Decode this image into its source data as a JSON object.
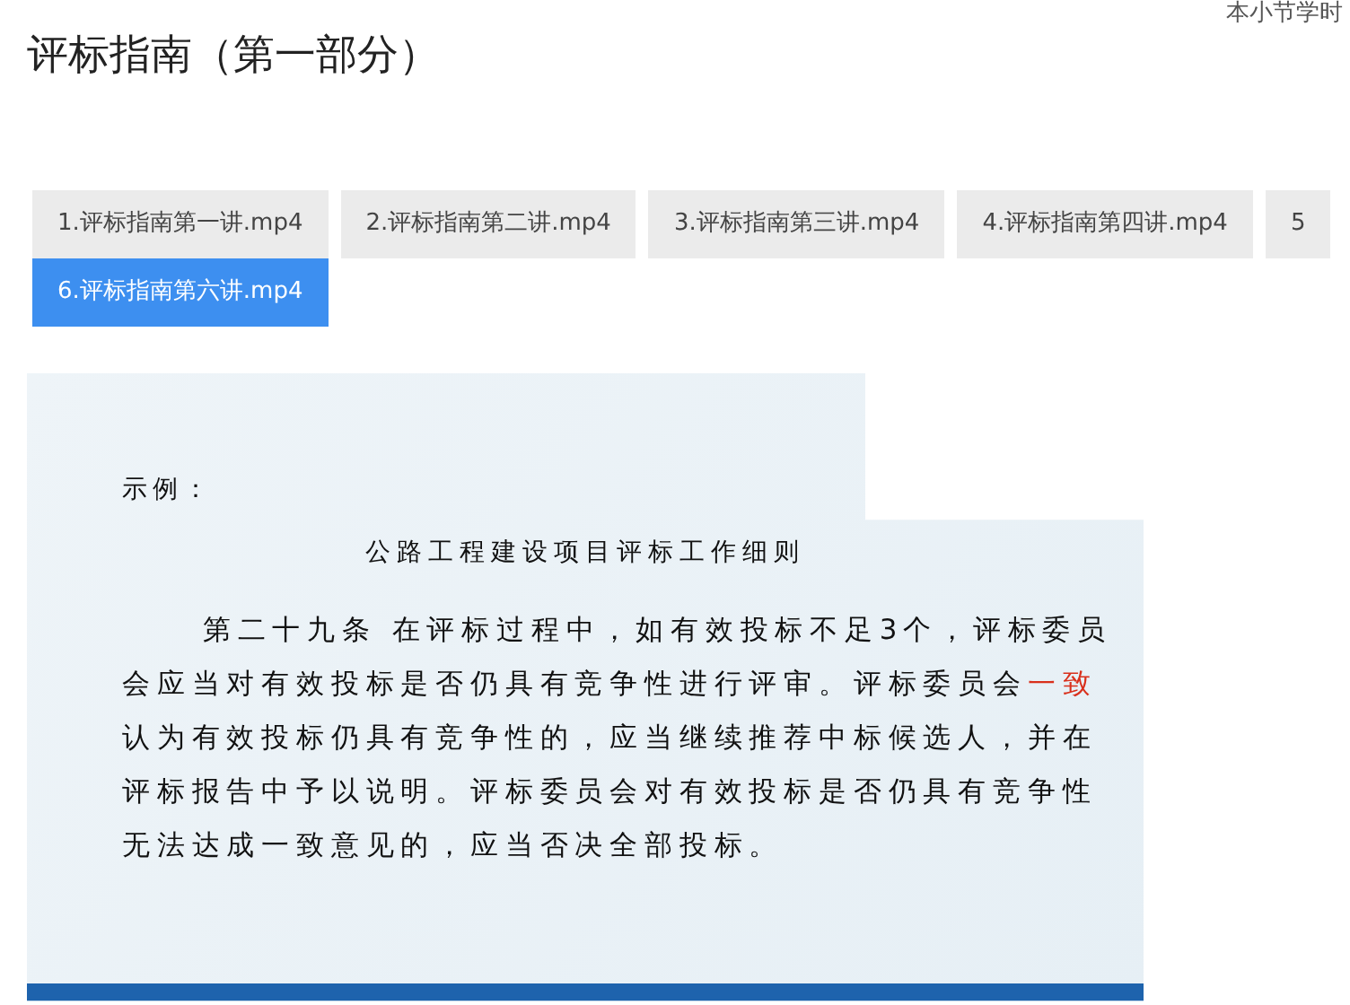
{
  "hours_label": "本小节学时",
  "title": "评标指南（第一部分）",
  "tabs": [
    {
      "label": "1.评标指南第一讲.mp4",
      "selected": false
    },
    {
      "label": "2.评标指南第二讲.mp4",
      "selected": false
    },
    {
      "label": "3.评标指南第三讲.mp4",
      "selected": false
    },
    {
      "label": "4.评标指南第四讲.mp4",
      "selected": false
    },
    {
      "label": "5",
      "selected": false
    },
    {
      "label": "6.评标指南第六讲.mp4",
      "selected": true
    }
  ],
  "slide": {
    "label": "示例：",
    "heading": "公路工程建设项目评标工作细则",
    "paragraph": [
      {
        "kind": "normal",
        "text": "第二十九条  在评标过程中，如有效投标不足3个，评标委员会应当对有效投标是否仍具有竞争性进行评审。评标委员会"
      },
      {
        "kind": "highlight",
        "text": "一致"
      },
      {
        "kind": "normal",
        "text": "认为有效投标仍具有竞争性的，应当继续推荐中标候选人，并在评标报告中予以说明。评标委员会对有效投标是否仍具有竞争性无法达成一致意见的，应当否决全部投标。"
      }
    ]
  }
}
